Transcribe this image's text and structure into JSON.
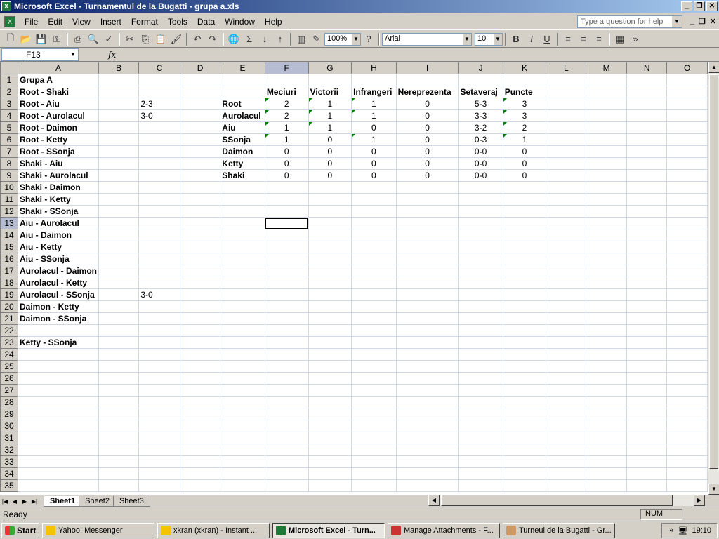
{
  "window": {
    "title": "Microsoft Excel - Turnamentul de la Bugatti - grupa a.xls"
  },
  "menu": [
    "File",
    "Edit",
    "View",
    "Insert",
    "Format",
    "Tools",
    "Data",
    "Window",
    "Help"
  ],
  "help_placeholder": "Type a question for help",
  "toolbar": {
    "zoom": "100%",
    "font": "Arial",
    "font_size": "10"
  },
  "namebox": "F13",
  "fx_label": "fx",
  "columns": [
    "A",
    "B",
    "C",
    "D",
    "E",
    "F",
    "G",
    "H",
    "I",
    "J",
    "K",
    "L",
    "M",
    "N",
    "O"
  ],
  "selected_column": "F",
  "selected_row": 13,
  "matches": [
    {
      "row": 1,
      "text": "Grupa A",
      "score": ""
    },
    {
      "row": 2,
      "text": "Root - Shaki",
      "score": ""
    },
    {
      "row": 3,
      "text": "Root - Aiu",
      "score": "2-3"
    },
    {
      "row": 4,
      "text": "Root - Aurolacul",
      "score": "3-0"
    },
    {
      "row": 5,
      "text": "Root - Daimon",
      "score": ""
    },
    {
      "row": 6,
      "text": "Root - Ketty",
      "score": ""
    },
    {
      "row": 7,
      "text": "Root - SSonja",
      "score": ""
    },
    {
      "row": 8,
      "text": "Shaki - Aiu",
      "score": ""
    },
    {
      "row": 9,
      "text": "Shaki - Aurolacul",
      "score": ""
    },
    {
      "row": 10,
      "text": "Shaki - Daimon",
      "score": ""
    },
    {
      "row": 11,
      "text": "Shaki - Ketty",
      "score": ""
    },
    {
      "row": 12,
      "text": "Shaki - SSonja",
      "score": ""
    },
    {
      "row": 13,
      "text": "Aiu - Aurolacul",
      "score": ""
    },
    {
      "row": 14,
      "text": "Aiu - Daimon",
      "score": ""
    },
    {
      "row": 15,
      "text": "Aiu - Ketty",
      "score": ""
    },
    {
      "row": 16,
      "text": "Aiu - SSonja",
      "score": ""
    },
    {
      "row": 17,
      "text": "Aurolacul - Daimon",
      "score": ""
    },
    {
      "row": 18,
      "text": "Aurolacul - Ketty",
      "score": ""
    },
    {
      "row": 19,
      "text": "Aurolacul - SSonja",
      "score": "3-0"
    },
    {
      "row": 20,
      "text": "Daimon - Ketty",
      "score": ""
    },
    {
      "row": 21,
      "text": "Daimon - SSonja",
      "score": ""
    },
    {
      "row": 23,
      "text": "Ketty - SSonja",
      "score": ""
    }
  ],
  "standings": {
    "headers": [
      "Meciuri",
      "Victorii",
      "Infrangeri",
      "Nereprezenta",
      "Setaveraj",
      "Puncte"
    ],
    "rows": [
      {
        "name": "Root",
        "vals": [
          "2",
          "1",
          "1",
          "0",
          "5-3",
          "3"
        ]
      },
      {
        "name": "Aurolacul",
        "vals": [
          "2",
          "1",
          "1",
          "0",
          "3-3",
          "3"
        ]
      },
      {
        "name": "Aiu",
        "vals": [
          "1",
          "1",
          "0",
          "0",
          "3-2",
          "2"
        ]
      },
      {
        "name": "SSonja",
        "vals": [
          "1",
          "0",
          "1",
          "0",
          "0-3",
          "1"
        ]
      },
      {
        "name": "Daimon",
        "vals": [
          "0",
          "0",
          "0",
          "0",
          "0-0",
          "0"
        ]
      },
      {
        "name": "Ketty",
        "vals": [
          "0",
          "0",
          "0",
          "0",
          "0-0",
          "0"
        ]
      },
      {
        "name": "Shaki",
        "vals": [
          "0",
          "0",
          "0",
          "0",
          "0-0",
          "0"
        ]
      }
    ]
  },
  "sheets": [
    "Sheet1",
    "Sheet2",
    "Sheet3"
  ],
  "status": {
    "ready": "Ready",
    "num": "NUM"
  },
  "taskbar": {
    "start": "Start",
    "tasks": [
      "Yahoo! Messenger",
      "xkran  (xkran) - Instant ...",
      "Microsoft Excel - Turn...",
      "Manage Attachments - F...",
      "Turneul de la Bugatti - Gr..."
    ],
    "clock": "19:10"
  }
}
